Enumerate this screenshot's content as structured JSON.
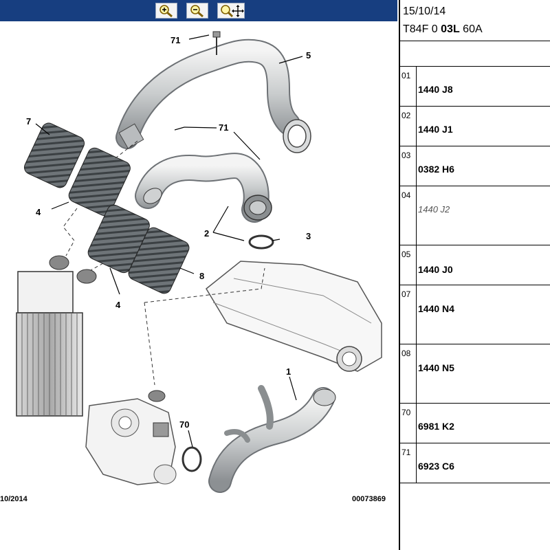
{
  "toolbar": {
    "buttons": [
      {
        "name": "zoom-in",
        "icon": "magnifier-plus-icon"
      },
      {
        "name": "zoom-out",
        "icon": "magnifier-minus-icon"
      },
      {
        "name": "zoom-pan",
        "icon": "magnifier-move-icon"
      }
    ]
  },
  "header": {
    "date": "15/10/14",
    "code_prefix": "T84F 0 ",
    "code_bold": "03L",
    "code_suffix": " 60A"
  },
  "parts": [
    {
      "num": "01",
      "ref": "1440 J8",
      "italic": false
    },
    {
      "num": "02",
      "ref": "1440 J1",
      "italic": false
    },
    {
      "num": "03",
      "ref": "0382 H6",
      "italic": false
    },
    {
      "num": "04",
      "ref": "1440 J2",
      "italic": true
    },
    {
      "num": "05",
      "ref": "1440 J0",
      "italic": false
    },
    {
      "num": "07",
      "ref": "1440 N4",
      "italic": false
    },
    {
      "num": "08",
      "ref": "1440 N5",
      "italic": false
    },
    {
      "num": "70",
      "ref": "6981 K2",
      "italic": false
    },
    {
      "num": "71",
      "ref": "6923 C6",
      "italic": false
    }
  ],
  "diagram": {
    "callouts": {
      "c71a": "71",
      "c5": "5",
      "c7": "7",
      "c71b": "71",
      "c4a": "4",
      "c2": "2",
      "c3": "3",
      "c4b": "4",
      "c8": "8",
      "c1": "1",
      "c70": "70"
    },
    "date_stamp": "10/2014",
    "doc_number": "00073869"
  }
}
